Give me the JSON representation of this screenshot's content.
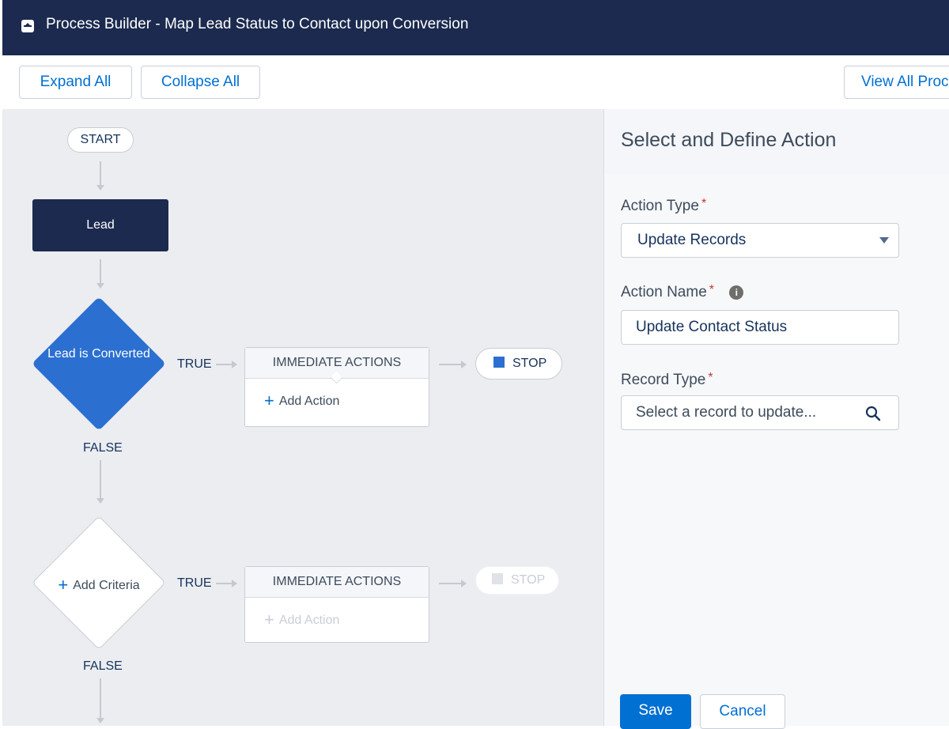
{
  "header": {
    "title": "Process Builder - Map Lead Status to Contact upon Conversion"
  },
  "toolbar": {
    "expand_all": "Expand All",
    "collapse_all": "Collapse All",
    "view_all": "View All Proc"
  },
  "canvas": {
    "start": "START",
    "object_node": "Lead",
    "criteria1": "Lead is Converted",
    "criteria2_add": "Add Criteria",
    "true_label": "TRUE",
    "false_label": "FALSE",
    "immediate_actions": "IMMEDIATE ACTIONS",
    "add_action": "Add Action",
    "stop": "STOP"
  },
  "panel": {
    "title": "Select and Define Action",
    "action_type_label": "Action Type",
    "action_type_value": "Update Records",
    "action_name_label": "Action Name",
    "action_name_value": "Update Contact Status",
    "record_type_label": "Record Type",
    "record_type_placeholder": "Select a record to update...",
    "required_mark": "*",
    "save": "Save",
    "cancel": "Cancel"
  },
  "colors": {
    "header_bg": "#1b2a4e",
    "accent": "#0070d2",
    "criteria_fill": "#2b6fd1",
    "canvas_bg": "#ebedf0"
  },
  "icons": [
    "app-icon",
    "dropdown-arrow-icon",
    "info-icon",
    "search-icon",
    "plus-icon",
    "stop-square-icon"
  ]
}
